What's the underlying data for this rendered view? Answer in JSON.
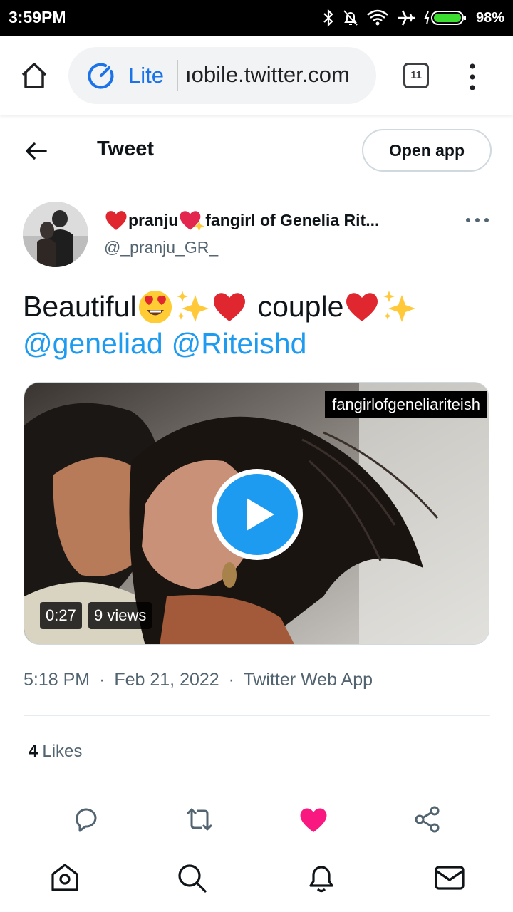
{
  "status_bar": {
    "time": "3:59PM",
    "battery_percent": "98%"
  },
  "browser": {
    "mode_label": "Lite",
    "url": "ıobile.twitter.com",
    "tab_count": "11"
  },
  "header": {
    "title": "Tweet",
    "open_app_label": "Open app"
  },
  "author": {
    "name": "pranju",
    "name_suffix": "fangirl of Genelia Rit...",
    "handle": "@_pranju_GR_"
  },
  "tweet": {
    "text_word1": "Beautiful",
    "text_word2": "couple",
    "mentions": [
      "@geneliad",
      "@Riteishd"
    ]
  },
  "video": {
    "watermark": "fangirlofgeneliariteish",
    "duration": "0:27",
    "views": "9 views"
  },
  "meta": {
    "time": "5:18 PM",
    "date": "Feb 21, 2022",
    "source": "Twitter Web App",
    "separator": "·"
  },
  "stats": {
    "likes_count": "4",
    "likes_label": "Likes"
  },
  "colors": {
    "accent": "#1d9bf0",
    "like": "#f91880",
    "lite": "#1a73e8"
  }
}
